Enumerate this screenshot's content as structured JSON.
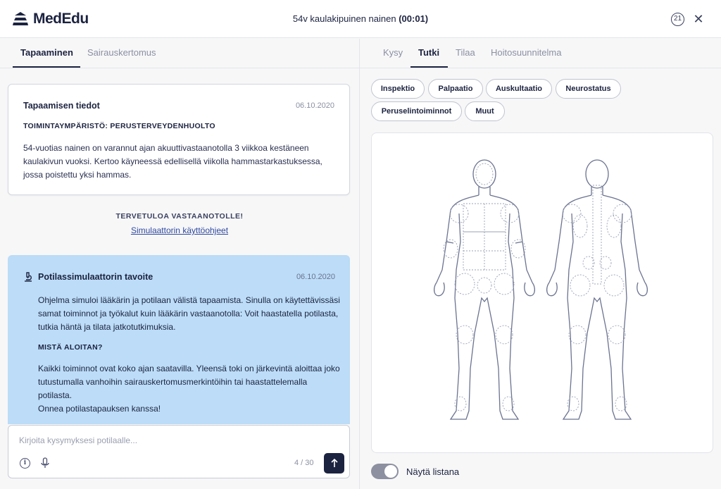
{
  "header": {
    "brand": "MedEdu",
    "case_title": "54v kaulakipuinen nainen",
    "timer": "(00:01)",
    "badge_count": "21"
  },
  "left_tabs": [
    {
      "label": "Tapaaminen",
      "active": true
    },
    {
      "label": "Sairauskertomus",
      "active": false
    }
  ],
  "info_card": {
    "title": "Tapaamisen tiedot",
    "date": "06.10.2020",
    "subtitle": "TOIMINTAYMPÄRISTÖ: PERUSTERVEYDENHUOLTO",
    "body": "54-vuotias nainen on varannut ajan akuuttivastaanotolla 3 viikkoa kestäneen kaulakivun vuoksi. Kertoo käyneessä edellisellä viikolla hammastarkastuksessa, jossa poistettu yksi hammas."
  },
  "welcome": {
    "title": "TERVETULOA VASTAANOTOLLE!",
    "link": "Simulaattorin käyttöohjeet"
  },
  "goal_card": {
    "title": "Potilassimulaattorin tavoite",
    "date": "06.10.2020",
    "paragraph1": "Ohjelma simuloi lääkärin ja potilaan välistä tapaamista. Sinulla on käytettävissäsi samat toiminnot ja työkalut kuin lääkärin vastaanotolla: Voit haastatella potilasta, tutkia häntä ja tilata jatkotutkimuksia.",
    "subtitle": "MISTÄ ALOITAN?",
    "paragraph2": "Kaikki toiminnot ovat koko ajan saatavilla. Yleensä toki on järkevintä aloittaa joko tutustumalla vanhoihin sairauskertomusmerkintöihin tai haastattelemalla potilasta.",
    "paragraph3": "Onnea potilastapauksen kanssa!"
  },
  "input": {
    "placeholder": "Kirjoita kysymyksesi potilaalle...",
    "value": "",
    "char_count": "4 / 30"
  },
  "right_tabs": [
    {
      "label": "Kysy",
      "active": false
    },
    {
      "label": "Tutki",
      "active": true
    },
    {
      "label": "Tilaa",
      "active": false
    },
    {
      "label": "Hoitosuunnitelma",
      "active": false
    }
  ],
  "exam_chips": [
    "Inspektio",
    "Palpaatio",
    "Auskultaatio",
    "Neurostatus",
    "Peruselintoiminnot",
    "Muut"
  ],
  "toggle": {
    "label": "Näytä listana",
    "on": true
  },
  "colors": {
    "primary": "#1c2340",
    "goal_card_bg": "#bcdcf7",
    "link": "#2f4aa0",
    "body_outline": "#6b7390"
  },
  "icons": {
    "logo": "mededu-logo-icon",
    "badge": "count-badge",
    "close": "close-icon",
    "goal": "microscope-icon",
    "info": "info-icon",
    "mic": "microphone-icon",
    "send": "arrow-up-icon"
  }
}
